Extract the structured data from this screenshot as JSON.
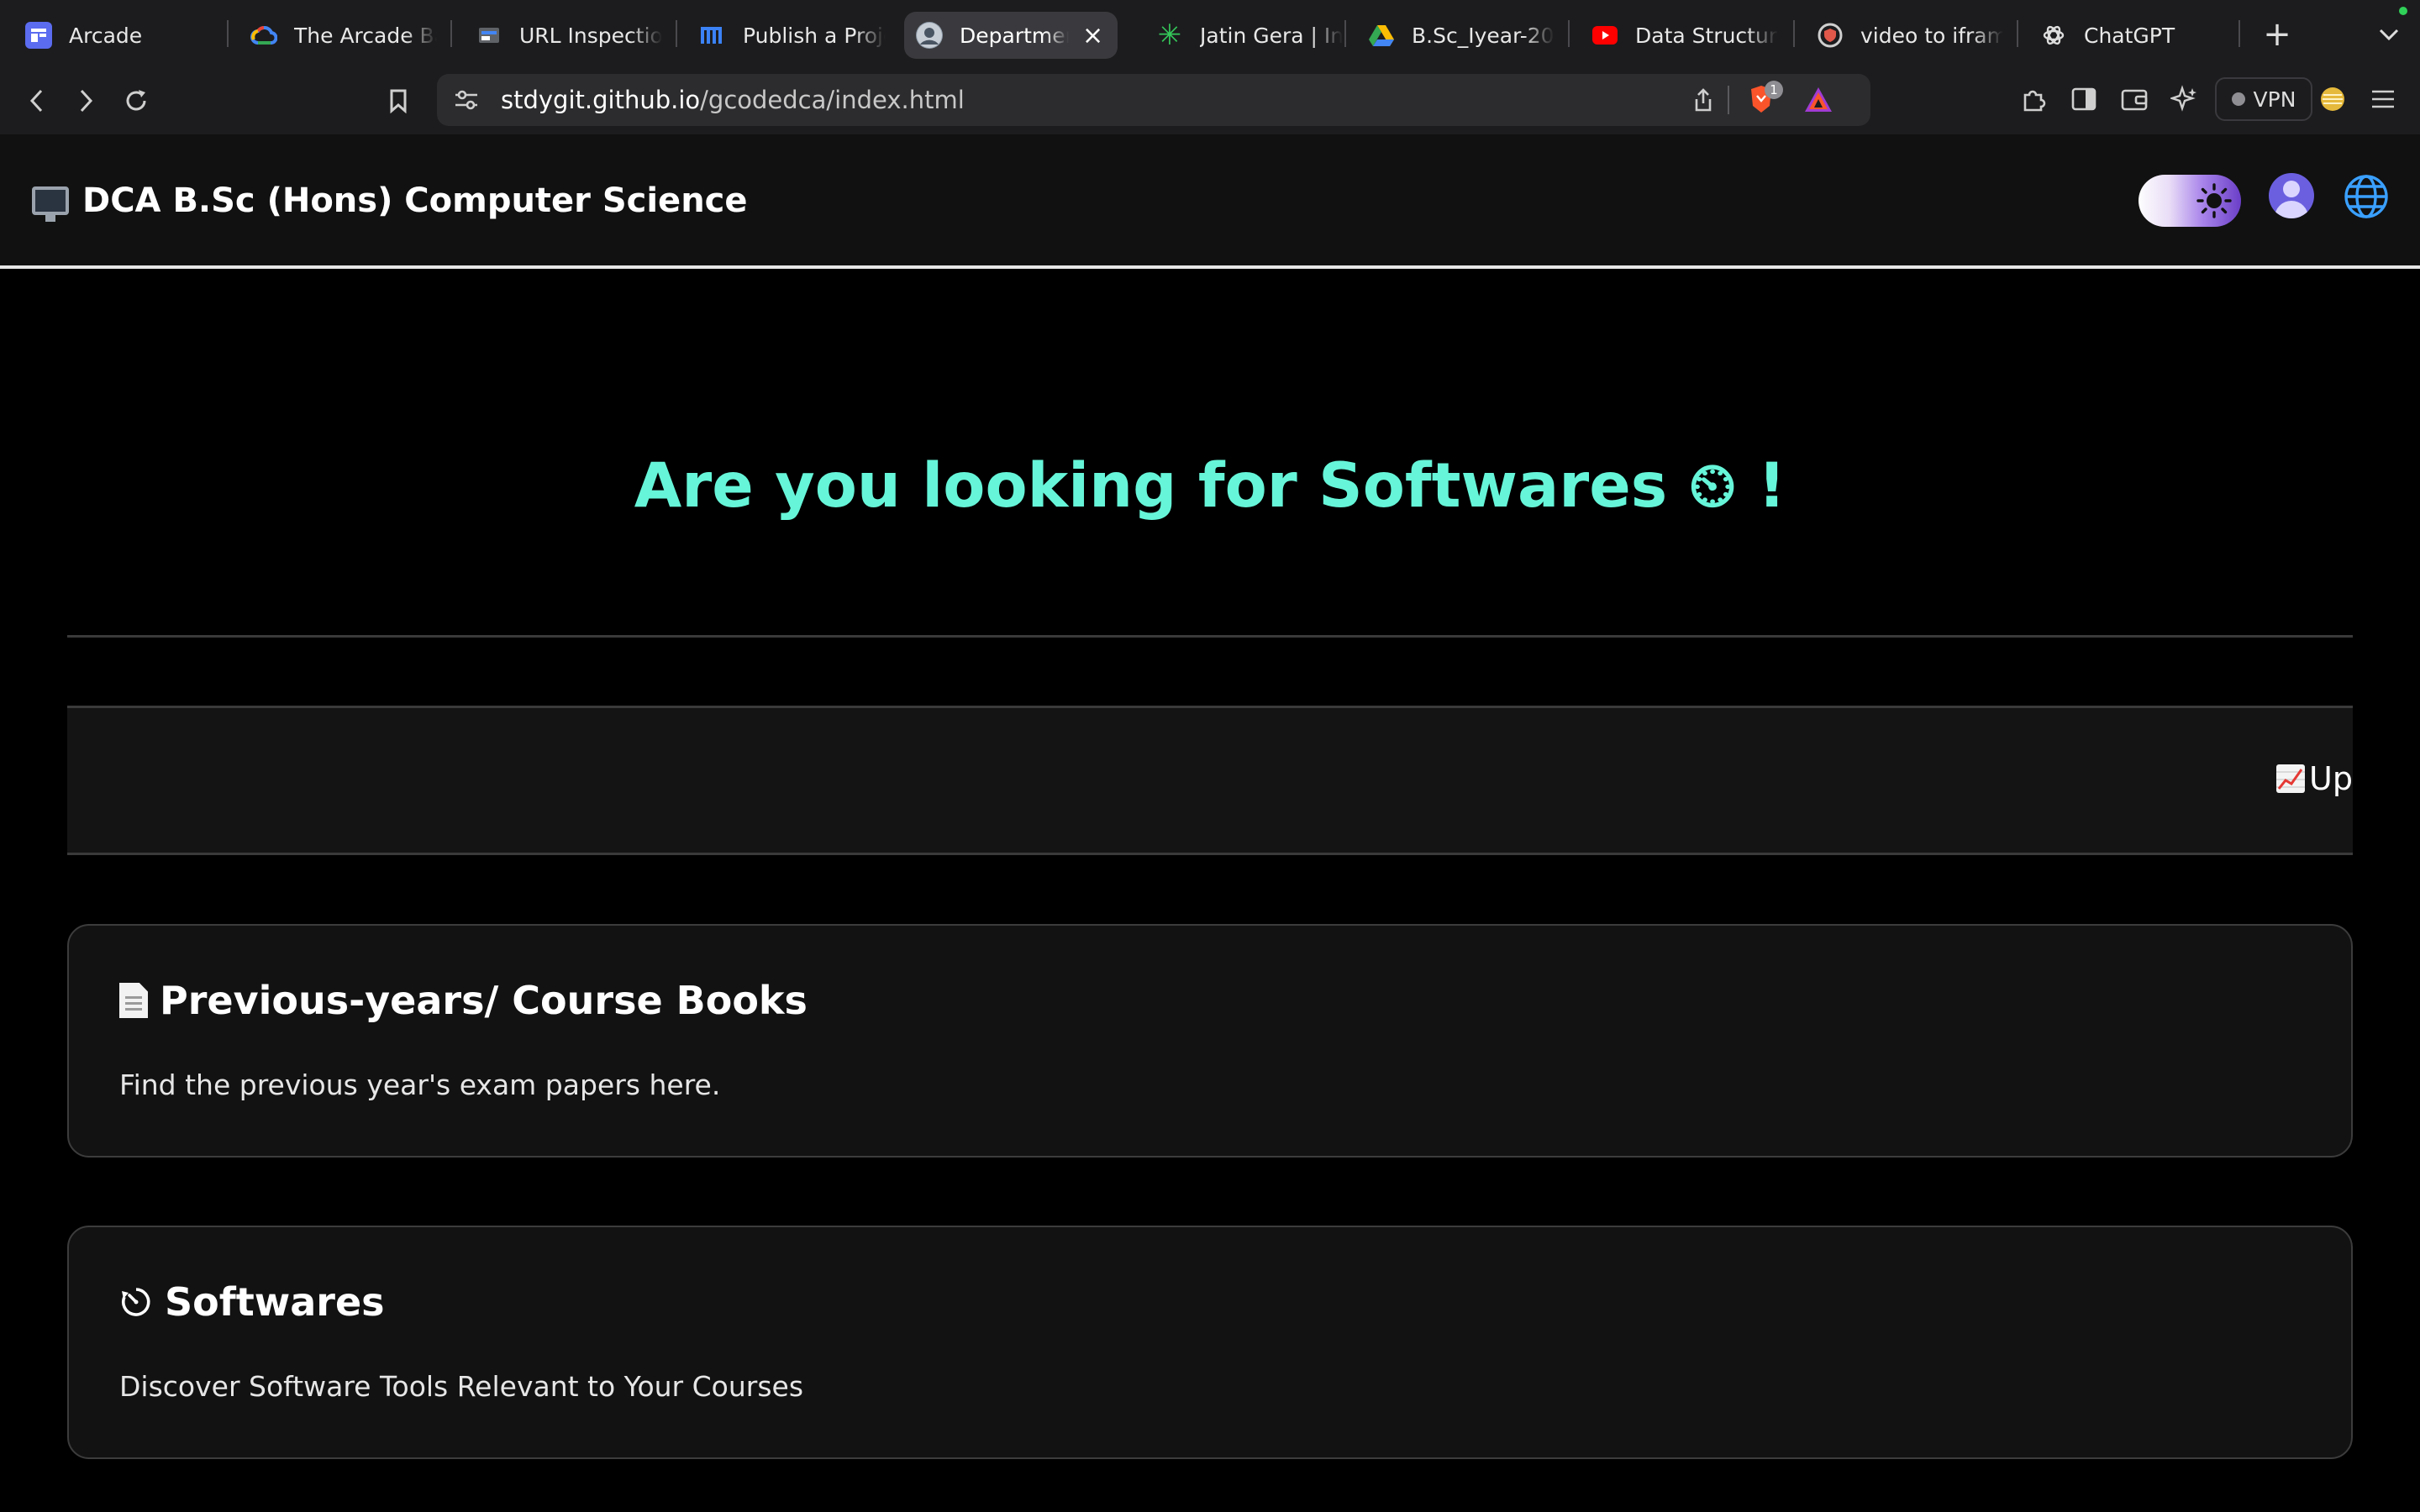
{
  "browser": {
    "tabs": [
      {
        "title": "Arcade",
        "icon": "arcade-icon",
        "color": "#5b6cf0"
      },
      {
        "title": "The Arcade Ba",
        "icon": "google-cloud-icon",
        "color": "#4285f4"
      },
      {
        "title": "URL Inspection",
        "icon": "search-console-icon",
        "color": "#4285f4"
      },
      {
        "title": "Publish a Proje",
        "icon": "devfolio-icon",
        "color": "#3b82f6"
      },
      {
        "title": "Departmen",
        "icon": "avatar-favicon-icon",
        "color": "#8e9aa8"
      },
      {
        "title": "Jatin Gera | Ins",
        "icon": "sparkle-icon",
        "color": "#34c759"
      },
      {
        "title": "B.Sc_Iyear-20",
        "icon": "google-drive-icon",
        "color": "#fbbc04"
      },
      {
        "title": "Data Structure",
        "icon": "youtube-icon",
        "color": "#ff0000"
      },
      {
        "title": "video to iframe",
        "icon": "shield-favicon-icon",
        "color": "#e0584a"
      },
      {
        "title": "ChatGPT",
        "icon": "chatgpt-icon",
        "color": "#dddddd"
      }
    ],
    "active_tab_index": 4,
    "url_host": "stdygit.github.io",
    "url_path": "/gcodedca/index.html",
    "brave_badge": "1",
    "vpn_label": "VPN"
  },
  "site": {
    "title": "DCA B.Sc (Hons) Computer Science",
    "accent_color": "#66f5d8"
  },
  "hero": {
    "text": "Are you looking for Softwares ⏲ !"
  },
  "ticker": {
    "text": "Upc"
  },
  "cards": [
    {
      "title": "Previous-years/ Course Books",
      "description": "Find the previous year's exam papers here.",
      "icon": "document-icon"
    },
    {
      "title": "Softwares",
      "description": "Discover Software Tools Relevant to Your Courses",
      "icon": "timer-icon"
    }
  ]
}
